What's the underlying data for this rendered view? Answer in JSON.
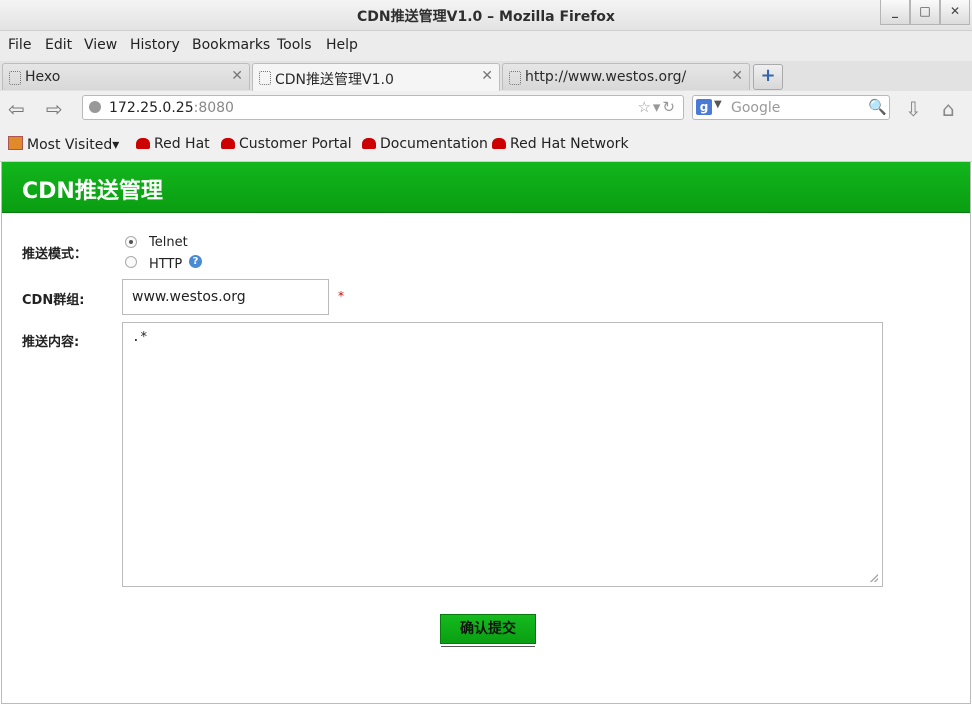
{
  "window": {
    "title": "CDN推送管理V1.0 – Mozilla Firefox",
    "buttons": [
      "_",
      "□",
      "✕"
    ]
  },
  "menu": [
    "File",
    "Edit",
    "View",
    "History",
    "Bookmarks",
    "Tools",
    "Help"
  ],
  "tabs": [
    {
      "label": "Hexo"
    },
    {
      "label": "CDN推送管理V1.0"
    },
    {
      "label": "http://www.westos.org/"
    }
  ],
  "navbar": {
    "url_host": "172.25.0.25",
    "url_port": ":8080",
    "search_placeholder": "Google",
    "search_engine_letter": "g"
  },
  "bookmarks": [
    "Most Visited",
    "Red Hat",
    "Customer Portal",
    "Documentation",
    "Red Hat Network"
  ],
  "page": {
    "header_title": "CDN推送管理",
    "mode_label": "推送模式：",
    "mode_options": [
      "Telnet",
      "HTTP"
    ],
    "mode_selected": "Telnet",
    "group_label": "CDN群组:",
    "group_value": "www.westos.org",
    "required_mark": "*",
    "content_label": "推送内容:",
    "content_value": ".*",
    "submit_label": "确认提交"
  },
  "colors": {
    "header_green": "#0fb01a",
    "required_red": "#dd0000"
  }
}
